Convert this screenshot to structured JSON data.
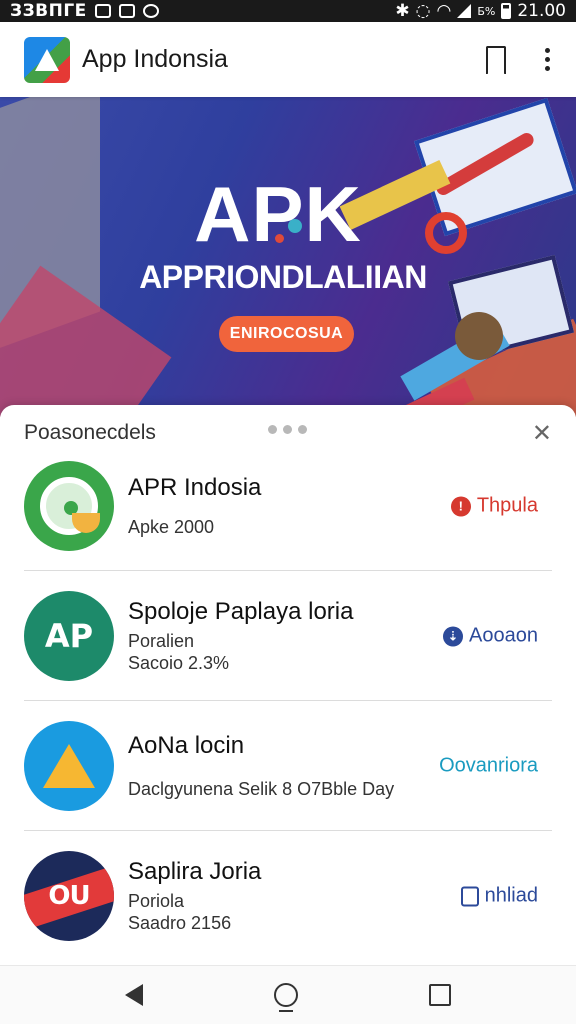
{
  "status_bar": {
    "left_text": "ЗЗВПГЕ",
    "time": "21.00",
    "battery_text": "Б%"
  },
  "app_bar": {
    "title": "App Indonsia"
  },
  "banner": {
    "title": "APK",
    "subtitle": "APPRIONDLALIIAN",
    "button_label": "ENIROCOSUA"
  },
  "sheet": {
    "title": "Poasonecdels",
    "close_glyph": "✕",
    "apps": [
      {
        "name": "APR Indosia",
        "lines": [
          "Apke 2000"
        ],
        "action_label": "Thpula",
        "action_color": "#d6392f",
        "icon": "green-camera-icon"
      },
      {
        "name": "Spoloje Paplaya loria",
        "lines": [
          "Poralien",
          "Sacoio 2.3%"
        ],
        "action_label": "Aooaon",
        "action_color": "#2c4a9a",
        "icon_text": "AP",
        "icon": "teal-ap-icon"
      },
      {
        "name": "AoNa locin",
        "lines": [
          "Daclgyunena Selik 8 O7Bble Day"
        ],
        "action_label": "Oovanriora",
        "action_color": "#1a9bc0",
        "icon": "blue-triangle-icon"
      },
      {
        "name": "Saplira Joria",
        "lines": [
          "Poriola",
          "Saadro 2156"
        ],
        "action_label": "nhliad",
        "action_color": "#2c4a9a",
        "icon_text": "OU",
        "icon": "red-band-icon"
      }
    ]
  },
  "colors": {
    "banner_button": "#f0643c",
    "status_bar": "#1a1a1a"
  }
}
